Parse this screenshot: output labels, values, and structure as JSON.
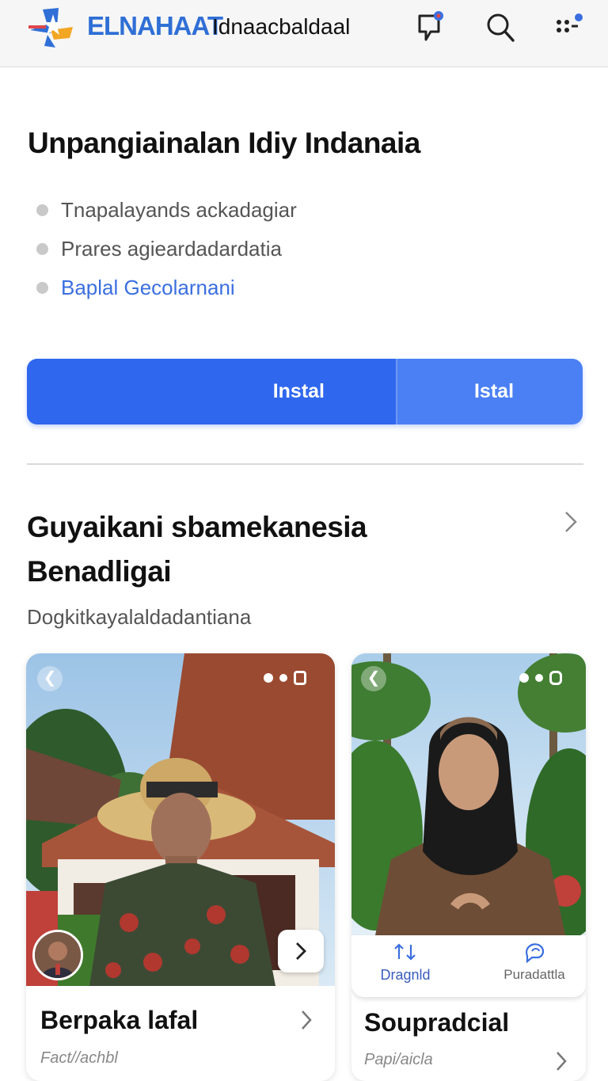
{
  "header": {
    "brand": "ELNAHAAT",
    "brand_sub": "Idnaacbaldaal",
    "icons": [
      "chat-alert-icon",
      "search-icon",
      "apps-menu-icon"
    ]
  },
  "intro": {
    "title": "Unpangiainalan Idiy Indanaia",
    "bullets": [
      {
        "text": "Tnapalayands ackadagiar"
      },
      {
        "text": "Prares agieardadardatia"
      },
      {
        "text": "Baplal Gecolarnani"
      }
    ]
  },
  "install": {
    "primary_label": "Instal",
    "secondary_label": "Istal"
  },
  "section": {
    "title": "Guyaikani sbamekanesia Benadligai",
    "subtitle": "Dogkitkayalaldadantiana"
  },
  "cards": [
    {
      "title": "Berpaka lafal",
      "subtitle": "Fact//achbl"
    },
    {
      "title": "Soupradcial",
      "subtitle": "Papi/aicla",
      "actions": [
        {
          "label": "Dragnld",
          "icon": "swap-arrows-icon"
        },
        {
          "label": "Puradattla",
          "icon": "chat-refresh-icon"
        }
      ]
    }
  ],
  "colors": {
    "primary": "#2f67ee",
    "secondary": "#4a80f4",
    "link": "#3b6fe0",
    "brand": "#2f6fd6"
  }
}
